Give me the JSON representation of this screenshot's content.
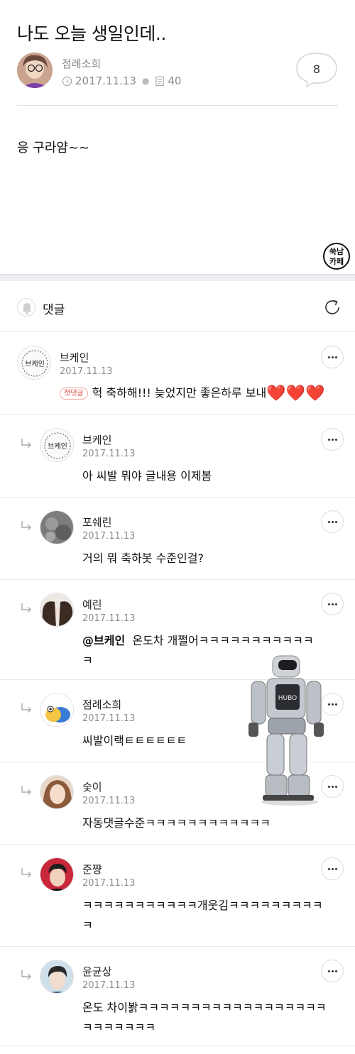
{
  "post": {
    "title": "나도 오늘 생일인데..",
    "author": "점례소희",
    "date": "2017.11.13",
    "views": "40",
    "comment_count": "8",
    "body": "응 구라얌~~",
    "cafe_logo": [
      "쑥남",
      "카페"
    ]
  },
  "comments_section": {
    "label": "댓글"
  },
  "comments": [
    {
      "author": "브케인",
      "date": "2017.11.13",
      "badge": "첫댓글",
      "text": "헉 축하해!!! 늦었지만 좋은하루 보내",
      "hearts": "❤️❤️❤️"
    },
    {
      "author": "브케인",
      "date": "2017.11.13",
      "text": "아 씨발 뭐야 글내용 이제봄"
    },
    {
      "author": "포쉐린",
      "date": "2017.11.13",
      "text": "거의 뭐 축하봇 수준인걸?"
    },
    {
      "author": "예린",
      "date": "2017.11.13",
      "mention": "@브케인",
      "text": "온도차 개쩔어ㅋㅋㅋㅋㅋㅋㅋㅋㅋㅋㅋ",
      "text2": "ㅋ"
    },
    {
      "author": "점례소희",
      "date": "2017.11.13",
      "text": "씨발이랙ㅌㅌㅌㅌㅌㅌ"
    },
    {
      "author": "숯이",
      "date": "2017.11.13",
      "text": "자동댓글수준ㅋㅋㅋㅋㅋㅋㅋㅋㅋㅋㅋㅋ"
    },
    {
      "author": "준쨩",
      "date": "2017.11.13",
      "text": "ㅋㅋㅋㅋㅋㅋㅋㅋㅋㅋㅋ개웃김ㅋㅋㅋㅋㅋㅋㅋㅋㅋ",
      "text2": "ㅋ"
    },
    {
      "author": "윤균상",
      "date": "2017.11.13",
      "text": "온도 차이봙ㅋㅋㅋㅋㅋㅋㅋㅋㅋㅋㅋㅋㅋㅋㅋㅋㅋㅋ",
      "text2": "ㅋㅋㅋㅋㅋㅋㅋ"
    }
  ],
  "robot_label": "HUBO"
}
